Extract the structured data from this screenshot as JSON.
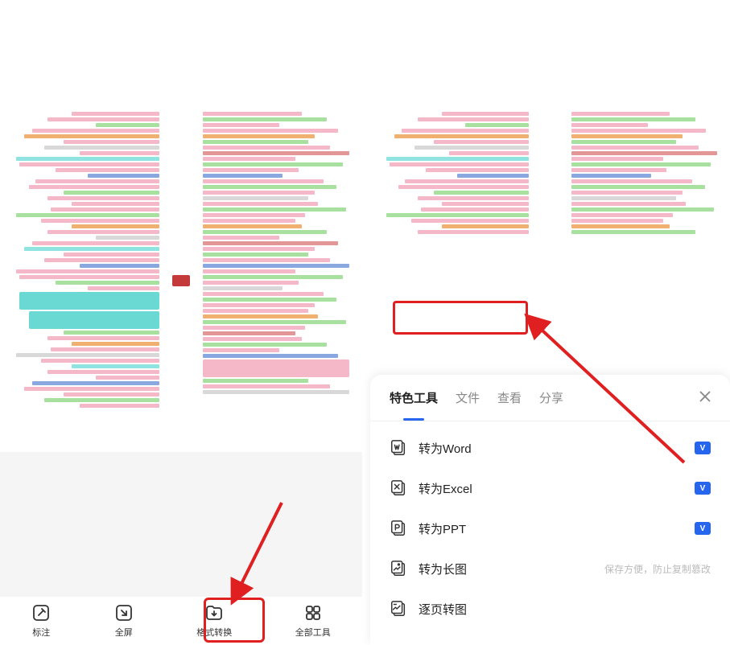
{
  "bottom_bar": {
    "items": [
      {
        "label": "标注"
      },
      {
        "label": "全屏"
      },
      {
        "label": "格式转换"
      },
      {
        "label": "全部工具"
      }
    ]
  },
  "sheet": {
    "tabs": [
      {
        "label": "特色工具",
        "active": true
      },
      {
        "label": "文件",
        "active": false
      },
      {
        "label": "查看",
        "active": false
      },
      {
        "label": "分享",
        "active": false
      }
    ],
    "items": [
      {
        "label": "转为Word",
        "badge": "V"
      },
      {
        "label": "转为Excel",
        "badge": "V"
      },
      {
        "label": "转为PPT",
        "badge": "V"
      },
      {
        "label": "转为长图",
        "hint": "保存方便，防止复制篡改"
      },
      {
        "label": "逐页转图"
      }
    ]
  }
}
